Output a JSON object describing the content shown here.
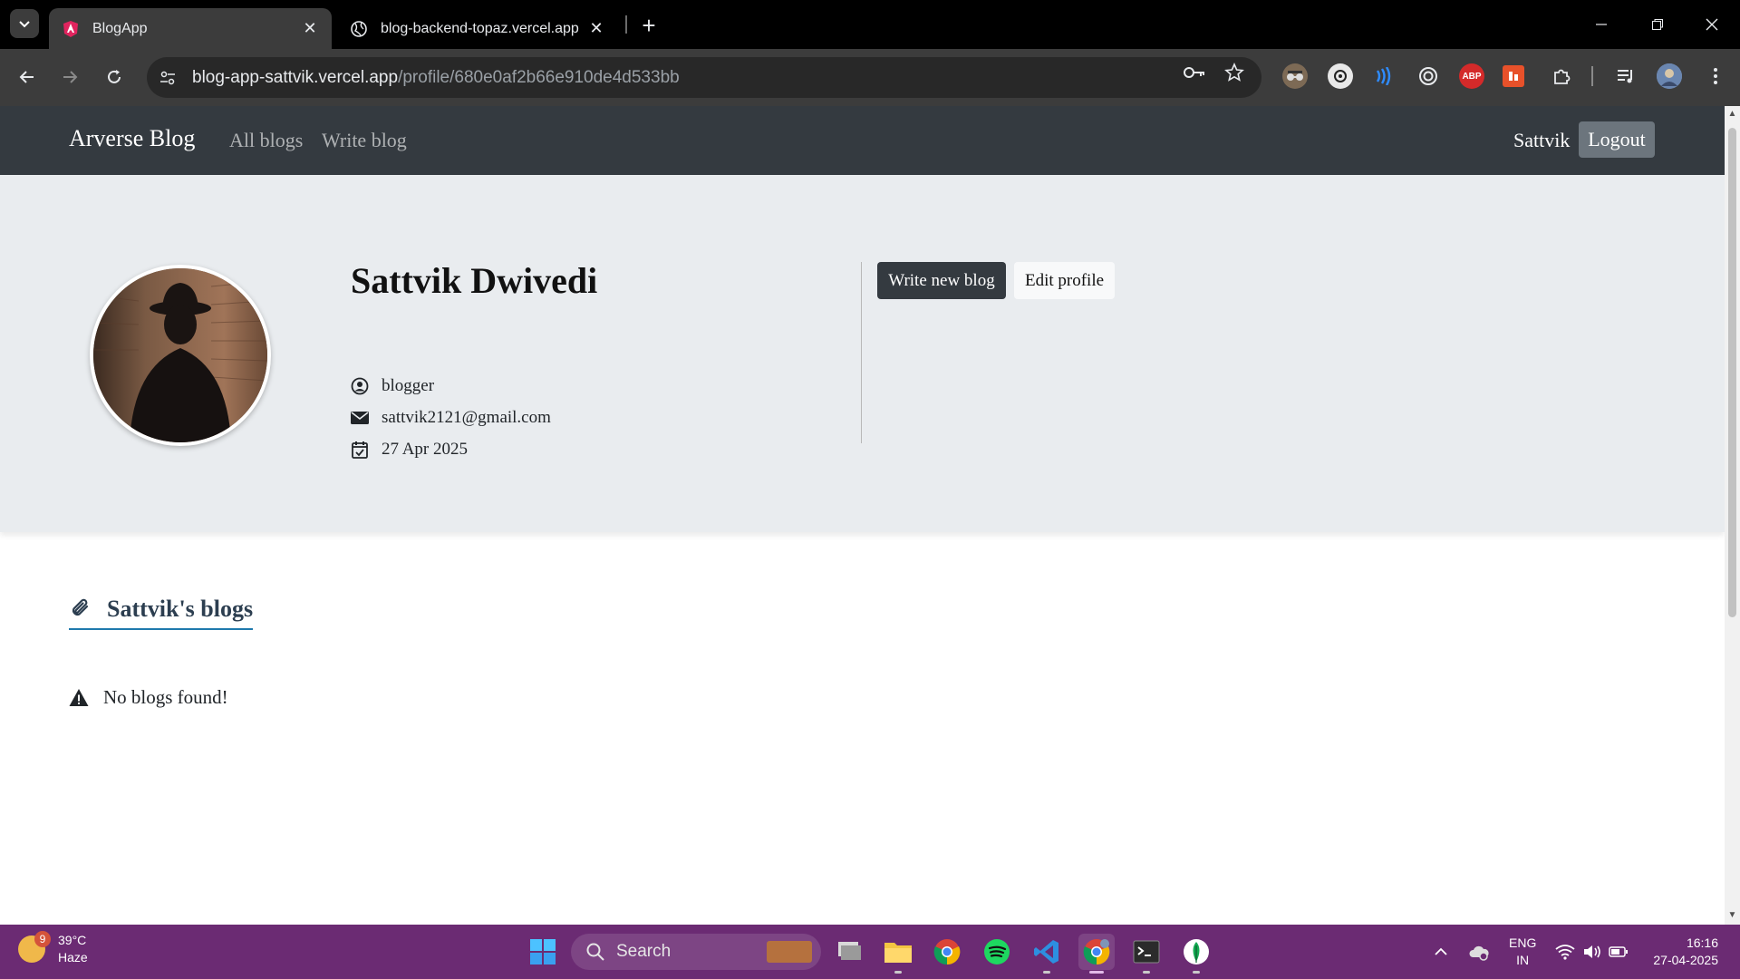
{
  "browser": {
    "tabs": [
      {
        "title": "BlogApp",
        "active": true
      },
      {
        "title": "blog-backend-topaz.vercel.app",
        "active": false
      }
    ],
    "url_host": "blog-app-sattvik.vercel.app",
    "url_path": "/profile/680e0af2b66e910de4d533bb",
    "extensions": [
      "spy-glasses-icon",
      "openai-icon",
      "reader-icon",
      "target-icon",
      "adblock-plus-icon",
      "office-icon",
      "puzzle-icon",
      "media-control-icon",
      "profile-avatar"
    ],
    "adblock_label": "ABP"
  },
  "navbar": {
    "brand": "Arverse Blog",
    "links": [
      "All blogs",
      "Write blog"
    ],
    "username": "Sattvik",
    "logout": "Logout"
  },
  "profile": {
    "name": "Sattvik Dwivedi",
    "role": "blogger",
    "email": "sattvik2121@gmail.com",
    "joined": "27 Apr 2025",
    "write_button": "Write new blog",
    "edit_button": "Edit profile"
  },
  "blogs": {
    "heading": "Sattvik's blogs",
    "empty_message": "No blogs found!"
  },
  "taskbar": {
    "weather_temp": "39°C",
    "weather_desc": "Haze",
    "weather_badge": "9",
    "search_placeholder": "Search",
    "language": "ENG",
    "region": "IN",
    "time": "16:16",
    "date": "27-04-2025"
  },
  "colors": {
    "navbar_bg": "#343a40",
    "hero_bg": "#e9ecef",
    "heading_underline": "#1f7aad",
    "taskbar_bg": "#6b2b73"
  }
}
